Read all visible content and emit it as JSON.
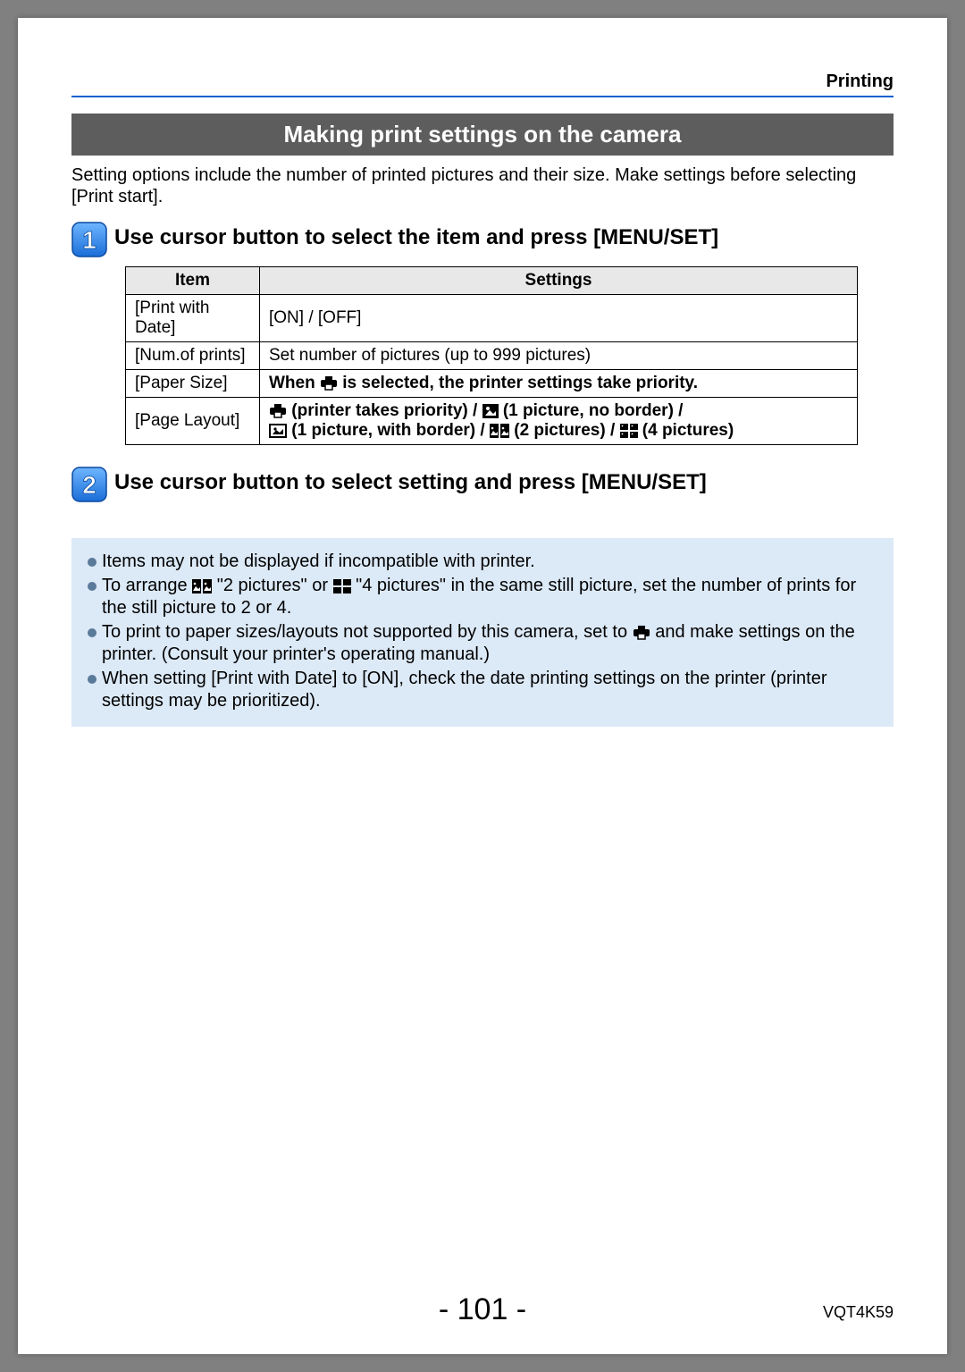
{
  "header": {
    "section_label": "Printing"
  },
  "title_bar": "Making print settings on the camera",
  "intro": "Setting options include the number of printed pictures and their size. Make settings before selecting [Print start].",
  "steps": {
    "s1": "Use cursor button to select the item and press [MENU/SET]",
    "s2": "Use cursor button to select setting and press [MENU/SET]"
  },
  "table": {
    "head_item": "Item",
    "head_settings": "Settings",
    "rows": [
      {
        "item": "[Print with Date]",
        "setting": "[ON] / [OFF]"
      },
      {
        "item": "[Num.of prints]",
        "setting": "Set number of pictures (up to 999 pictures)"
      },
      {
        "item": "[Paper Size]",
        "setting_pre": "When ",
        "setting_post": " is selected, the printer settings take priority."
      },
      {
        "item": "[Page Layout]",
        "opt1": " (printer takes priority) / ",
        "opt2": " (1 picture, no border) /",
        "opt3": " (1 picture, with border) / ",
        "opt4": " (2 pictures) / ",
        "opt5": " (4 pictures)"
      }
    ]
  },
  "notes": {
    "n1": "Items may not be displayed if incompatible with printer.",
    "n2a": "To arrange ",
    "n2b": " \"2 pictures\" or ",
    "n2c": " \"4 pictures\" in the same still picture, set the number of prints for the still picture to 2 or 4.",
    "n3a": "To print to paper sizes/layouts not supported by this camera, set to ",
    "n3b": " and make settings on the printer. (Consult your printer's operating manual.)",
    "n4": "When setting [Print with Date] to [ON], check the date printing settings on the printer (printer settings may be prioritized)."
  },
  "footer": {
    "page": "- 101 -",
    "docid": "VQT4K59"
  }
}
